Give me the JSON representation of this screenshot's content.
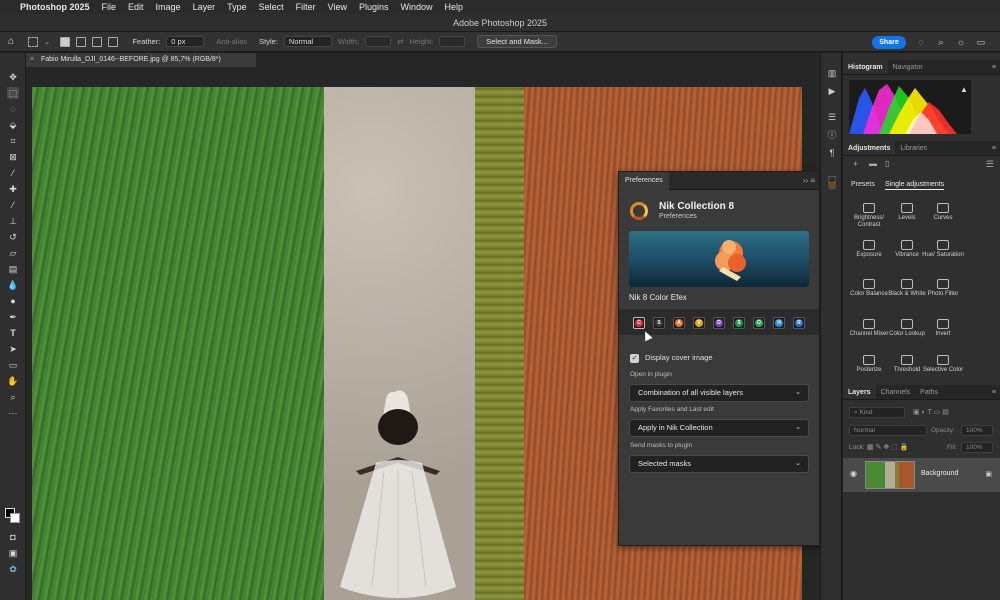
{
  "menubar": {
    "app_name": "Photoshop 2025",
    "items": [
      "File",
      "Edit",
      "Image",
      "Layer",
      "Type",
      "Select",
      "Filter",
      "View",
      "Plugins",
      "Window",
      "Help"
    ]
  },
  "window_title": "Adobe Photoshop 2025",
  "options": {
    "feather_label": "Feather:",
    "feather_value": "0 px",
    "antialias_label": "Anti-alias",
    "style_label": "Style:",
    "style_value": "Normal",
    "width_label": "Width:",
    "height_label": "Height:",
    "select_mask_label": "Select and Mask...",
    "share_label": "Share"
  },
  "document_tab": "Fabio Mirulla_DJI_0146--BEFORE.jpg @ 85,7% (RGB/8*)",
  "panels": {
    "top_tabs": [
      "Histogram",
      "Navigator"
    ],
    "adj_tabs": [
      "Adjustments",
      "Libraries"
    ],
    "adj_subtabs": [
      "Presets",
      "Single adjustments"
    ],
    "adjustments": [
      {
        "label": "Brightness/ Contrast",
        "icon": "brightness-icon"
      },
      {
        "label": "Levels",
        "icon": "levels-icon"
      },
      {
        "label": "Curves",
        "icon": "curves-icon"
      },
      {
        "label": "Exposure",
        "icon": "exposure-icon"
      },
      {
        "label": "Vibrance",
        "icon": "vibrance-icon"
      },
      {
        "label": "Hue/ Saturation",
        "icon": "hue-icon"
      },
      {
        "label": "Color Balance",
        "icon": "color-balance-icon"
      },
      {
        "label": "Black & White",
        "icon": "bw-icon"
      },
      {
        "label": "Photo Filter",
        "icon": "photo-filter-icon"
      },
      {
        "label": "Channel Mixer",
        "icon": "channel-mixer-icon"
      },
      {
        "label": "Color Lookup",
        "icon": "color-lookup-icon"
      },
      {
        "label": "Invert",
        "icon": "invert-icon"
      },
      {
        "label": "Posterize",
        "icon": "posterize-icon"
      },
      {
        "label": "Threshold",
        "icon": "threshold-icon"
      },
      {
        "label": "Selective Color",
        "icon": "selective-color-icon"
      }
    ],
    "layer_tabs": [
      "Layers",
      "Channels",
      "Paths"
    ],
    "kind_placeholder": "Kind",
    "blend_mode": "Normal",
    "opacity_label": "Opacity:",
    "opacity_value": "100%",
    "lock_label": "Lock:",
    "fill_label": "Fill:",
    "fill_value": "100%",
    "layer_name": "Background"
  },
  "prefs": {
    "tab_label": "Preferences",
    "title": "Nik Collection 8",
    "subtitle": "Preferences",
    "cover_name": "Nik 8 Color Efex",
    "plugins": [
      {
        "letter": "C",
        "color": "#d8323a"
      },
      {
        "letter": "S",
        "color": "#3a3a3a"
      },
      {
        "letter": "A",
        "color": "#e2762a"
      },
      {
        "letter": "V",
        "color": "#e3a51f"
      },
      {
        "letter": "D",
        "color": "#7a45c8"
      },
      {
        "letter": "S",
        "color": "#1f9b4a"
      },
      {
        "letter": "O",
        "color": "#27a85a"
      },
      {
        "letter": "H",
        "color": "#2e8fd8"
      },
      {
        "letter": "R",
        "color": "#2e6fd8"
      }
    ],
    "display_cover_label": "Display cover image",
    "open_in_label": "Open in plugin",
    "open_in_value": "Combination of all visible layers",
    "apply_label": "Apply Favorites and Last edit",
    "apply_value": "Apply in Nik Collection",
    "masks_label": "Send masks to plugin",
    "masks_value": "Selected masks"
  },
  "colors": {
    "accent": "#1473e6",
    "panel_bg": "#2f2f2f"
  }
}
